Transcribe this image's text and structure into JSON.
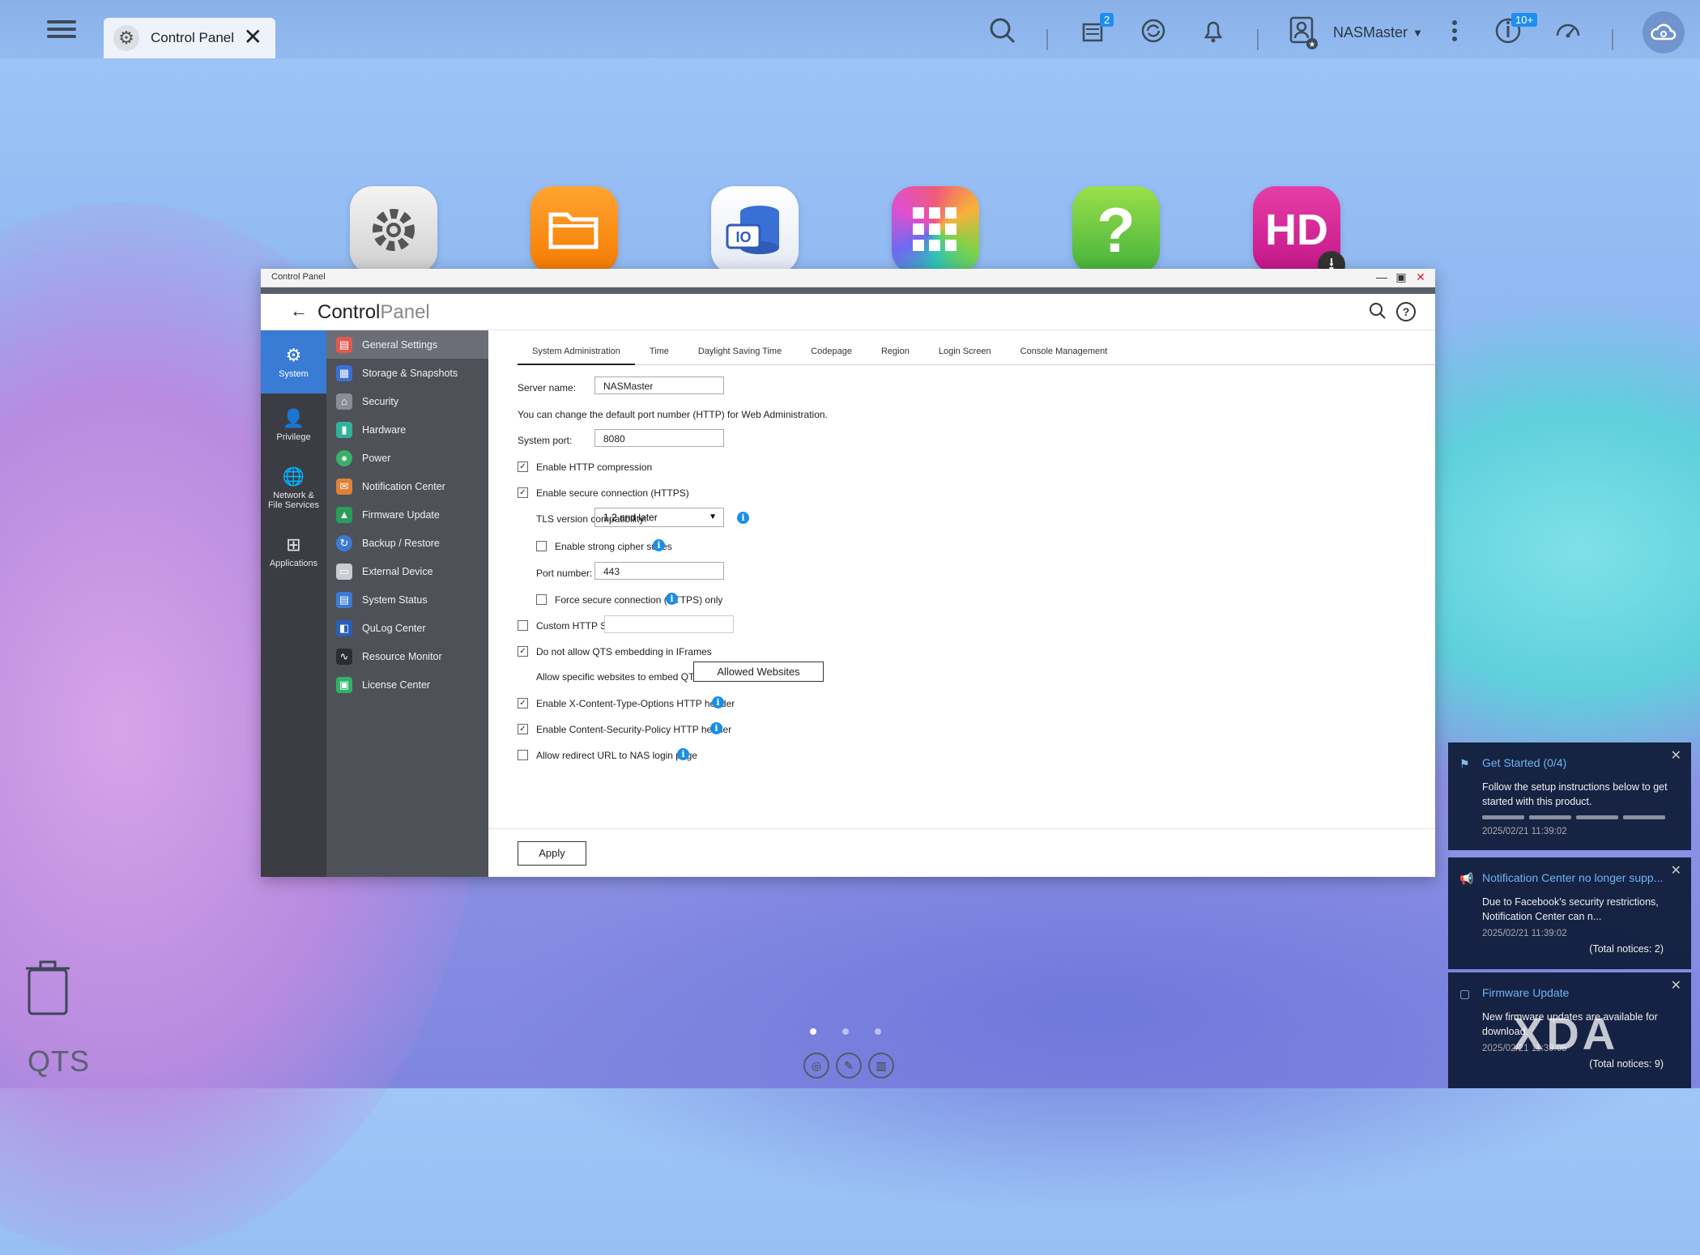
{
  "topbar": {
    "tab_label": "Control Panel",
    "badge_tasks": "2",
    "username": "NASMaster",
    "badge_updates": "10+"
  },
  "desktop": {
    "icons": [
      "control-panel",
      "file-station",
      "storage-snapshots",
      "app-center",
      "help-center",
      "hd-station"
    ],
    "brand": "QTS",
    "page_indicator": [
      "1",
      "2",
      "3"
    ],
    "active_page": 1
  },
  "window": {
    "title": "Control Panel",
    "header_a": "Control",
    "header_b": "Panel"
  },
  "leftnav": [
    {
      "label": "System",
      "icon": "gear-icon"
    },
    {
      "label": "Privilege",
      "icon": "user-icon"
    },
    {
      "label": "Network & File Services",
      "icon": "globe-icon"
    },
    {
      "label": "Applications",
      "icon": "apps-icon"
    }
  ],
  "subnav": [
    "General Settings",
    "Storage & Snapshots",
    "Security",
    "Hardware",
    "Power",
    "Notification Center",
    "Firmware Update",
    "Backup / Restore",
    "External Device",
    "System Status",
    "QuLog Center",
    "Resource Monitor",
    "License Center"
  ],
  "tabs": [
    "System Administration",
    "Time",
    "Daylight Saving Time",
    "Codepage",
    "Region",
    "Login Screen",
    "Console Management"
  ],
  "form": {
    "server_name_label": "Server name:",
    "server_name_value": "NASMaster",
    "port_note": "You can change the default port number (HTTP) for Web Administration.",
    "system_port_label": "System port:",
    "system_port_value": "8080",
    "http_compression": "Enable HTTP compression",
    "https": "Enable secure connection (HTTPS)",
    "tls_label": "TLS version compatibility:",
    "tls_value": "1.2 and later",
    "strong_cipher": "Enable strong cipher suites",
    "port_number_label": "Port number:",
    "port_number_value": "443",
    "force_https": "Force secure connection (HTTPS) only",
    "custom_header": "Custom HTTP Server header:",
    "no_iframe": "Do not allow QTS embedding in IFrames",
    "allow_specific": "Allow specific websites to embed QTS in IFrames",
    "allowed_websites_button": "Allowed Websites",
    "x_content": "Enable X-Content-Type-Options HTTP header",
    "csp": "Enable Content-Security-Policy HTTP header",
    "redirect": "Allow redirect URL to NAS login page",
    "apply": "Apply"
  },
  "notifications": [
    {
      "title": "Get Started (0/4)",
      "body": "Follow the setup instructions below to get started with this product.",
      "date": "2025/02/21 11:39:02",
      "total": "",
      "progress": 0
    },
    {
      "title": "Notification Center no longer supp...",
      "body": "Due to Facebook's security restrictions, Notification Center can n...",
      "date": "2025/02/21 11:39:02",
      "total": "(Total notices: 2)"
    },
    {
      "title": "Firmware Update",
      "body": "New firmware updates are available for download.",
      "date": "2025/02/21 11:39:05",
      "total": "(Total notices: 9)"
    }
  ],
  "watermark": "XDA",
  "colors": {
    "accent": "#3a7bd5",
    "info": "#1a8ee8",
    "notice_title": "#6fb3f2"
  }
}
